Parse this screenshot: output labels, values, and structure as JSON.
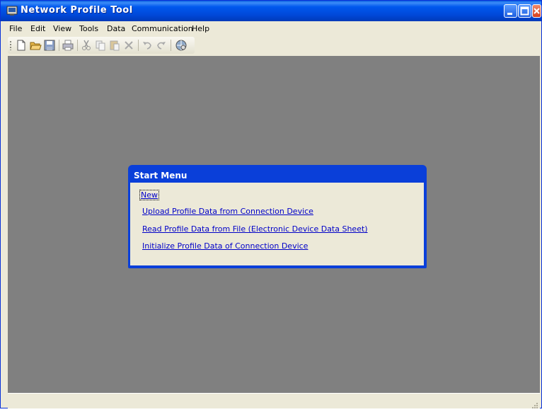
{
  "window": {
    "title": "Network Profile Tool"
  },
  "menubar": {
    "items": [
      "File",
      "Edit",
      "View",
      "Tools",
      "Data",
      "Communication",
      "Help"
    ]
  },
  "toolbar": {
    "icons": [
      "new-icon",
      "open-icon",
      "save-icon",
      "print-icon",
      "cut-icon",
      "copy-icon",
      "paste-icon",
      "delete-icon",
      "undo-icon",
      "redo-icon",
      "network-icon"
    ]
  },
  "start_menu": {
    "title": "Start Menu",
    "links": [
      "New",
      "Upload Profile Data from Connection Device",
      "Read Profile Data from File (Electronic Device Data Sheet)",
      "Initialize Profile Data of Connection Device"
    ]
  },
  "colors": {
    "titlebar": "#0058EE",
    "workspace": "#808080",
    "link": "#0000C8"
  }
}
